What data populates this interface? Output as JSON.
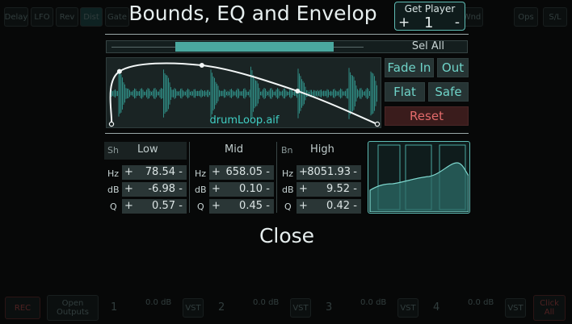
{
  "background": {
    "top_buttons": [
      "Delay",
      "LFO",
      "Rev",
      "Dist",
      "Gate",
      "Wnd",
      "Ops",
      "S/L"
    ],
    "bottom": {
      "rec_label": "REC",
      "open_outputs_label": "Open\nOutputs",
      "channels": [
        {
          "number": "1",
          "db": "0.0 dB",
          "vst": "VST"
        },
        {
          "number": "2",
          "db": "0.0 dB",
          "vst": "VST"
        },
        {
          "number": "3",
          "db": "0.0 dB",
          "vst": "VST"
        },
        {
          "number": "4",
          "db": "0.0 dB",
          "vst": "VST"
        }
      ],
      "click_label": "Click\nAll"
    }
  },
  "dialog": {
    "title": "Bounds, EQ and Envelop",
    "get_player": {
      "label": "Get Player",
      "plus": "+",
      "value": "1",
      "minus": "-"
    },
    "selection": {
      "label": "Sel All",
      "start_fraction": 0.19,
      "end_fraction": 0.63
    },
    "envelope": {
      "file_name": "drumLoop.aif",
      "points": [
        {
          "t": 0.0,
          "level": 0.0
        },
        {
          "t": 0.03,
          "level": 0.86
        },
        {
          "t": 0.34,
          "level": 0.96
        },
        {
          "t": 0.7,
          "level": 0.54
        },
        {
          "t": 1.0,
          "level": 0.0
        }
      ]
    },
    "buttons": {
      "fade_in": "Fade In",
      "out": "Out",
      "flat": "Flat",
      "safe": "Safe",
      "reset": "Reset"
    },
    "eq": {
      "low": {
        "tag": "Sh",
        "name": "Low",
        "hz": "78.54",
        "db": "-6.98",
        "q": "0.57"
      },
      "mid": {
        "tag": "",
        "name": "Mid",
        "hz": "658.05",
        "db": "0.10",
        "q": "0.45"
      },
      "high": {
        "tag": "Bn",
        "name": "High",
        "hz": "8051.93",
        "db": "9.52",
        "q": "0.42"
      },
      "row_labels": {
        "hz": "Hz",
        "db": "dB",
        "q": "Q"
      },
      "plus": "+",
      "minus": "-"
    },
    "close_label": "Close"
  },
  "colors": {
    "accent": "#5fbcb4",
    "selection": "#4aa89f",
    "file_label": "#40cfc4",
    "reset_text": "#e26a6a",
    "reset_bg": "#3a1c1c"
  }
}
